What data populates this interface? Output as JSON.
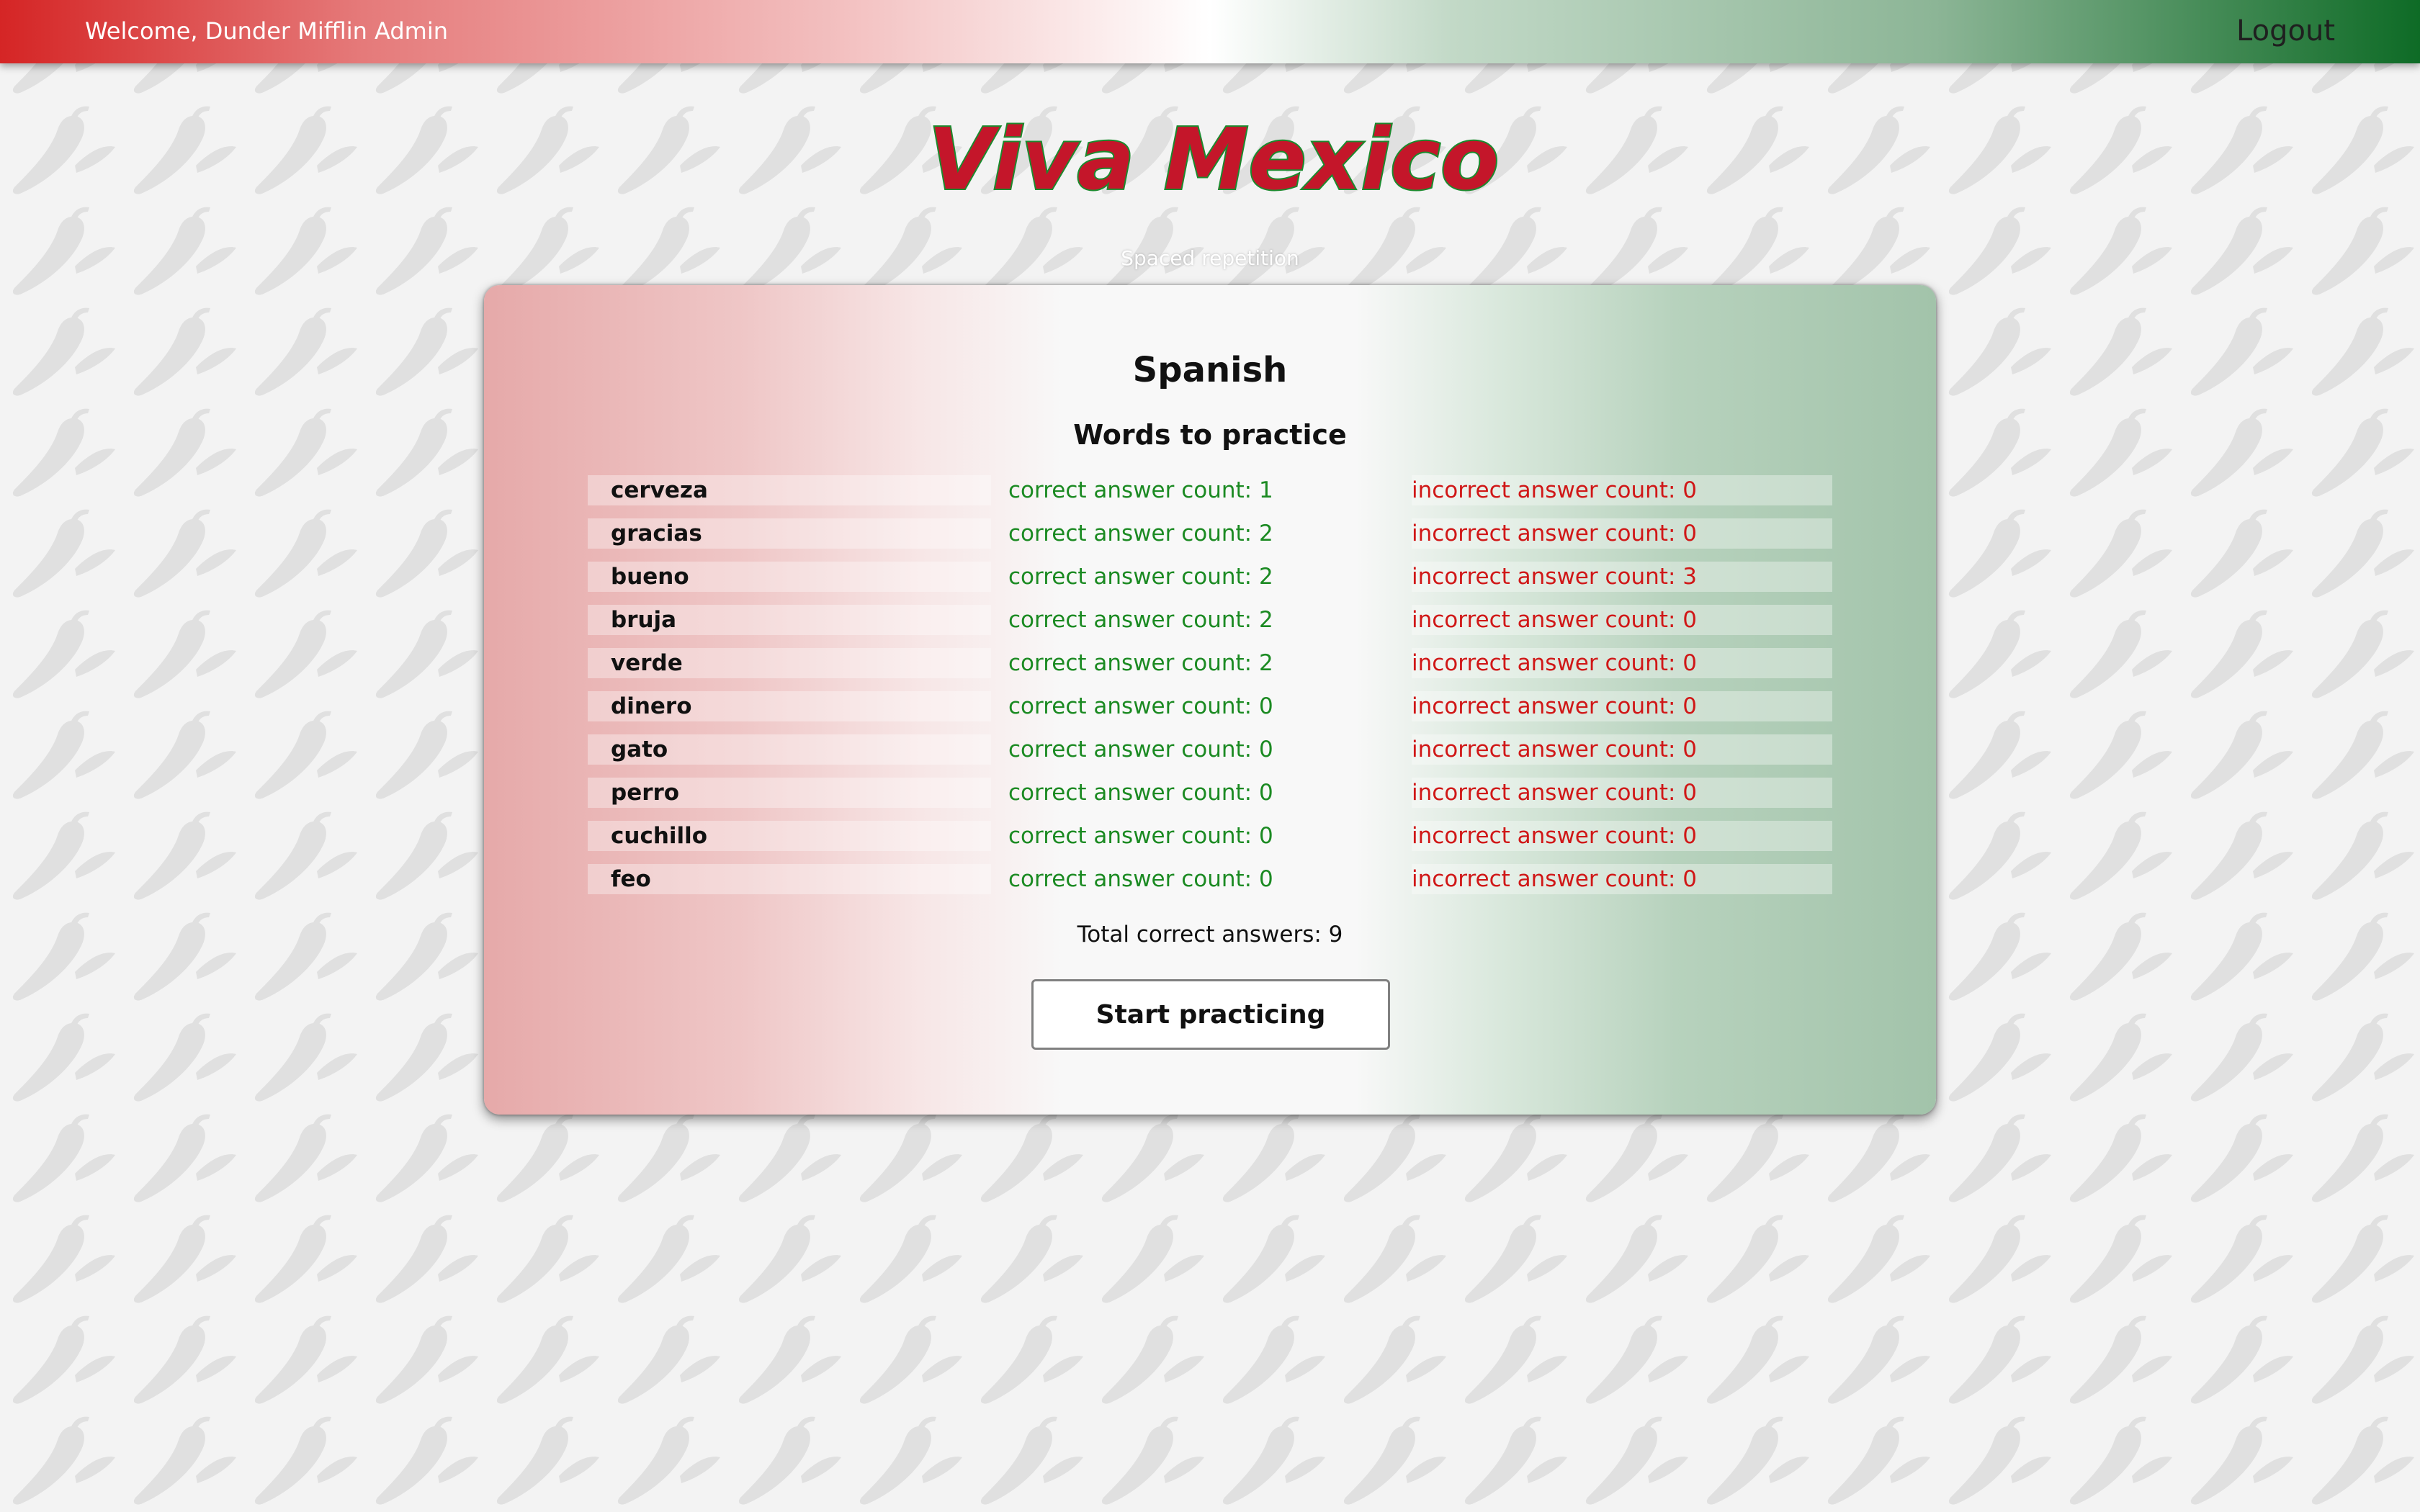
{
  "header": {
    "welcome_text": "Welcome, Dunder Mifflin Admin",
    "logout_label": "Logout"
  },
  "brand": {
    "logo_text": "¡Viva Mexico!",
    "subtitle": "Spaced repetition",
    "logo_color": "#c4162a",
    "logo_outline_color": "#1c8a2e"
  },
  "dashboard": {
    "language": "Spanish",
    "section_title": "Words to practice",
    "words": [
      {
        "word": "cerveza",
        "correct": "correct answer count: 1",
        "incorrect": "incorrect answer count: 0"
      },
      {
        "word": "gracias",
        "correct": "correct answer count: 2",
        "incorrect": "incorrect answer count: 0"
      },
      {
        "word": "bueno",
        "correct": "correct answer count: 2",
        "incorrect": "incorrect answer count: 3"
      },
      {
        "word": "bruja",
        "correct": "correct answer count: 2",
        "incorrect": "incorrect answer count: 0"
      },
      {
        "word": "verde",
        "correct": "correct answer count: 2",
        "incorrect": "incorrect answer count: 0"
      },
      {
        "word": "dinero",
        "correct": "correct answer count: 0",
        "incorrect": "incorrect answer count: 0"
      },
      {
        "word": "gato",
        "correct": "correct answer count: 0",
        "incorrect": "incorrect answer count: 0"
      },
      {
        "word": "perro",
        "correct": "correct answer count: 0",
        "incorrect": "incorrect answer count: 0"
      },
      {
        "word": "cuchillo",
        "correct": "correct answer count: 0",
        "incorrect": "incorrect answer count: 0"
      },
      {
        "word": "feo",
        "correct": "correct answer count: 0",
        "incorrect": "incorrect answer count: 0"
      }
    ],
    "total_text": "Total correct answers: 9",
    "start_label": "Start practicing"
  },
  "colors": {
    "flag_red": "#d52525",
    "flag_green": "#0e6b26",
    "correct_text": "#1b8a22",
    "incorrect_text": "#d01717"
  }
}
